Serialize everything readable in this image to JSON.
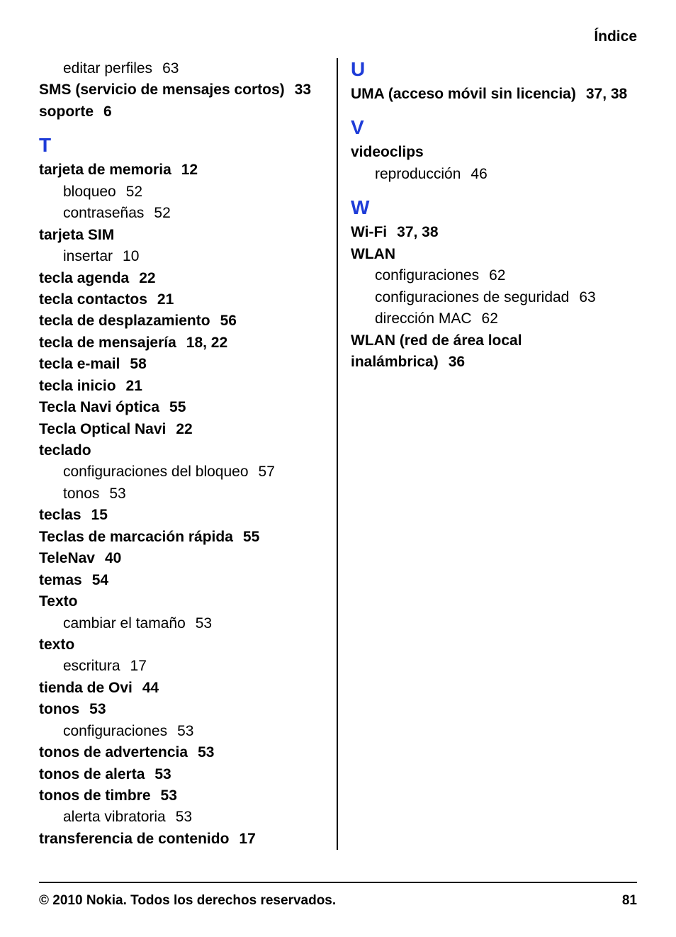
{
  "header": "Índice",
  "footer": {
    "copyright": "© 2010 Nokia. Todos los derechos reservados.",
    "page": "81"
  },
  "left_pre": [
    {
      "type": "sub",
      "label": "editar perfiles",
      "pages": "63"
    },
    {
      "type": "entry",
      "label": "SMS (servicio de mensajes cortos)",
      "pages": "33"
    },
    {
      "type": "entry",
      "label": "soporte",
      "pages": "6"
    }
  ],
  "left_sections": [
    {
      "letter": "T",
      "items": [
        {
          "type": "entry",
          "label": "tarjeta de memoria",
          "pages": "12"
        },
        {
          "type": "sub",
          "label": "bloqueo",
          "pages": "52"
        },
        {
          "type": "sub",
          "label": "contraseñas",
          "pages": "52"
        },
        {
          "type": "entry",
          "label": "tarjeta SIM",
          "pages": ""
        },
        {
          "type": "sub",
          "label": "insertar",
          "pages": "10"
        },
        {
          "type": "entry",
          "label": "tecla agenda",
          "pages": "22"
        },
        {
          "type": "entry",
          "label": "tecla contactos",
          "pages": "21"
        },
        {
          "type": "entry",
          "label": "tecla de desplazamiento",
          "pages": "56"
        },
        {
          "type": "entry",
          "label": "tecla de mensajería",
          "pages": "18, 22"
        },
        {
          "type": "entry",
          "label": "tecla e-mail",
          "pages": "58"
        },
        {
          "type": "entry",
          "label": "tecla inicio",
          "pages": "21"
        },
        {
          "type": "entry",
          "label": "Tecla Navi óptica",
          "pages": "55"
        },
        {
          "type": "entry",
          "label": "Tecla Optical Navi",
          "pages": "22"
        },
        {
          "type": "entry",
          "label": "teclado",
          "pages": ""
        },
        {
          "type": "sub",
          "label": "configuraciones del bloqueo",
          "pages": "57"
        },
        {
          "type": "sub",
          "label": "tonos",
          "pages": "53"
        },
        {
          "type": "entry",
          "label": "teclas",
          "pages": "15"
        },
        {
          "type": "entry",
          "label": "Teclas de marcación rápida",
          "pages": "55"
        },
        {
          "type": "entry",
          "label": "TeleNav",
          "pages": "40"
        },
        {
          "type": "entry",
          "label": "temas",
          "pages": "54"
        },
        {
          "type": "entry",
          "label": "Texto",
          "pages": ""
        },
        {
          "type": "sub",
          "label": "cambiar el tamaño",
          "pages": "53"
        },
        {
          "type": "entry",
          "label": "texto",
          "pages": ""
        },
        {
          "type": "sub",
          "label": "escritura",
          "pages": "17"
        },
        {
          "type": "entry",
          "label": "tienda de Ovi",
          "pages": "44"
        },
        {
          "type": "entry",
          "label": "tonos",
          "pages": "53"
        },
        {
          "type": "sub",
          "label": "configuraciones",
          "pages": "53"
        },
        {
          "type": "entry",
          "label": "tonos de advertencia",
          "pages": "53"
        },
        {
          "type": "entry",
          "label": "tonos de alerta",
          "pages": "53"
        },
        {
          "type": "entry",
          "label": "tonos de timbre",
          "pages": "53"
        },
        {
          "type": "sub",
          "label": "alerta vibratoria",
          "pages": "53"
        },
        {
          "type": "entry",
          "label": "transferencia de contenido",
          "pages": "17"
        }
      ]
    }
  ],
  "right_sections": [
    {
      "letter": "U",
      "items": [
        {
          "type": "entry",
          "label": "UMA (acceso móvil sin licencia)",
          "pages": "37, 38"
        }
      ]
    },
    {
      "letter": "V",
      "items": [
        {
          "type": "entry",
          "label": "videoclips",
          "pages": ""
        },
        {
          "type": "sub",
          "label": "reproducción",
          "pages": "46"
        }
      ]
    },
    {
      "letter": "W",
      "items": [
        {
          "type": "entry",
          "label": "Wi-Fi",
          "pages": "37, 38"
        },
        {
          "type": "entry",
          "label": "WLAN",
          "pages": ""
        },
        {
          "type": "sub",
          "label": "configuraciones",
          "pages": "62"
        },
        {
          "type": "sub",
          "label": "configuraciones de seguridad",
          "pages": "63"
        },
        {
          "type": "sub",
          "label": "dirección MAC",
          "pages": "62"
        },
        {
          "type": "entry",
          "label": "WLAN (red de área local inalámbrica)",
          "pages": "36"
        }
      ]
    }
  ]
}
